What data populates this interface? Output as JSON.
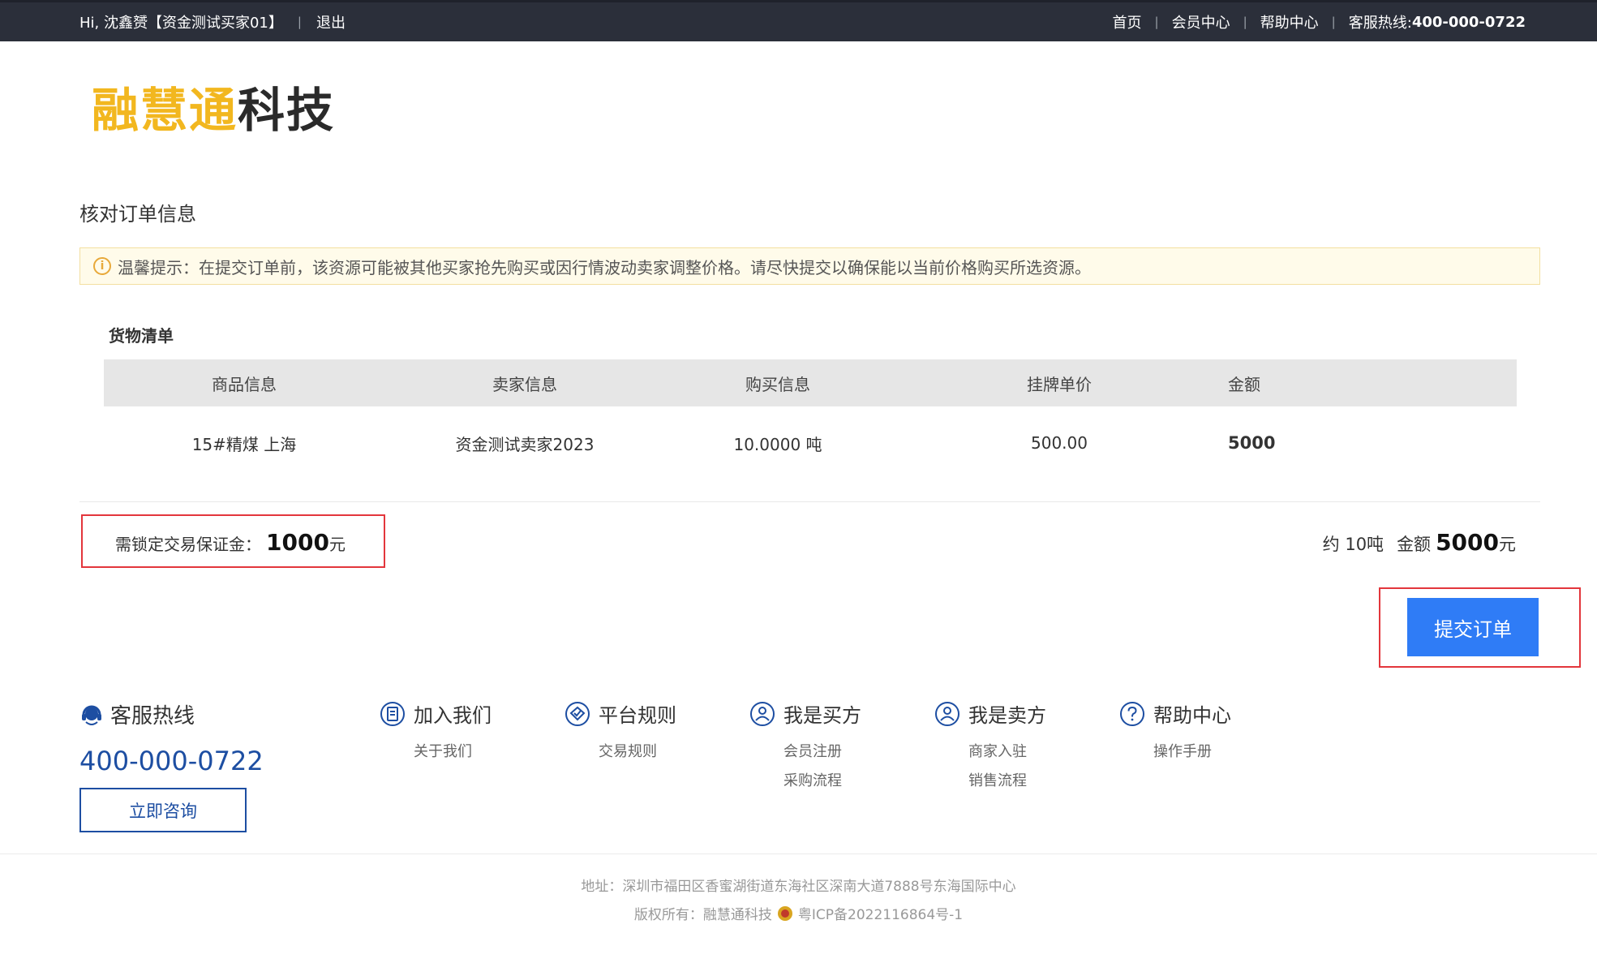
{
  "topbar": {
    "greeting": "Hi,  沈鑫赟【资金测试买家01】",
    "logout": "退出",
    "nav": [
      "首页",
      "会员中心",
      "帮助中心"
    ],
    "hotline_label": "客服热线:",
    "hotline_number": "400-000-0722"
  },
  "logo": {
    "part1": "融慧通",
    "part2": "科技"
  },
  "page_title": "核对订单信息",
  "notice": "温馨提示：在提交订单前，该资源可能被其他买家抢先购买或因行情波动卖家调整价格。请尽快提交以确保能以当前价格购买所选资源。",
  "goods": {
    "title": "货物清单",
    "headers": [
      "商品信息",
      "卖家信息",
      "购买信息",
      "挂牌单价",
      "金额"
    ],
    "row": {
      "product": "15#精煤 上海",
      "seller": "资金测试卖家2023",
      "purchase": "10.0000 吨",
      "unit_price": "500.00",
      "amount": "5000"
    }
  },
  "deposit": {
    "label": "需锁定交易保证金：",
    "value": "1000",
    "unit": "元"
  },
  "summary": {
    "qty": "约 10吨",
    "amount_label": "金额",
    "amount": "5000",
    "unit": "元"
  },
  "submit_label": "提交订单",
  "footer": {
    "hotline_title": "客服热线",
    "hotline_number": "400-000-0722",
    "consult_label": "立即咨询",
    "columns": [
      {
        "title": "加入我们",
        "links": [
          "关于我们"
        ]
      },
      {
        "title": "平台规则",
        "links": [
          "交易规则"
        ]
      },
      {
        "title": "我是买方",
        "links": [
          "会员注册",
          "采购流程"
        ]
      },
      {
        "title": "我是卖方",
        "links": [
          "商家入驻",
          "销售流程"
        ]
      },
      {
        "title": "帮助中心",
        "links": [
          "操作手册"
        ]
      }
    ],
    "address": "地址：深圳市福田区香蜜湖街道东海社区深南大道7888号东海国际中心",
    "copyright": "版权所有：融慧通科技",
    "icp": "粤ICP备2022116864号-1"
  },
  "colors": {
    "accent_blue": "#2f7cf6",
    "logo_gold": "#f2b71f",
    "highlight_red": "#e3363c",
    "topbar_bg": "#2b2f3a"
  }
}
